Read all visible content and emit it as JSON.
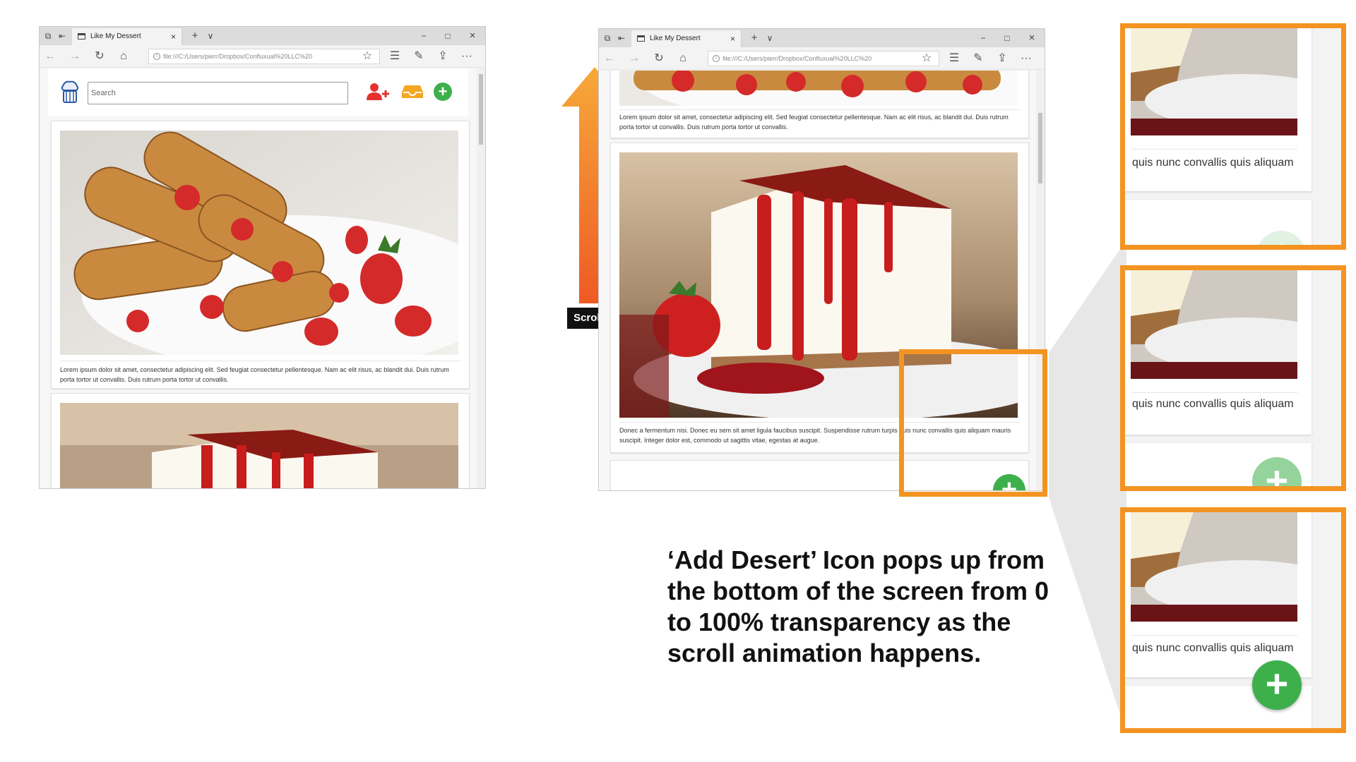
{
  "browser": {
    "tab_title": "Like My Dessert",
    "url": "file:///C:/Users/pierr/Dropbox/Confluxual%20LLC%20",
    "new_tab": "+",
    "tab_menu": "∨",
    "close_tab": "×",
    "minimize": "−",
    "maximize": "□",
    "close_window": "×",
    "more": "···"
  },
  "site": {
    "search_placeholder": "Search"
  },
  "posts": [
    {
      "caption": "Lorem ipsum dolor sit amet, consectetur adipiscing elit. Sed feugiat consectetur pellentesque. Nam ac elit risus, ac blandit dui. Duis rutrum porta tortor ut convallis. Duis rutrum porta tortor ut convallis."
    },
    {
      "caption": "Donec a fermentum nisi. Donec eu sem sit amet ligula faucibus suscipit. Suspendisse rutrum turpis quis nunc convallis quis aliquam mauris suscipit. Integer dolor est, commodo ut sagittis vitae, egestas at augue."
    }
  ],
  "annotation": {
    "scroll_label": "Scroll Up",
    "callout": "‘Add Desert’ Icon pops up from the bottom of the screen from 0 to 100% transparency as the scroll animation happens.",
    "frame_caption": "quis nunc convallis quis aliquam",
    "plus_opacity_stages": [
      0.15,
      0.55,
      1.0
    ]
  },
  "colors": {
    "accent_orange": "#f39422",
    "add_green": "#3db04b",
    "user_red": "#e5322d",
    "inbox_orange": "#f5a623",
    "arrow_top": "#f7a93a",
    "arrow_bottom": "#ee5a24"
  }
}
